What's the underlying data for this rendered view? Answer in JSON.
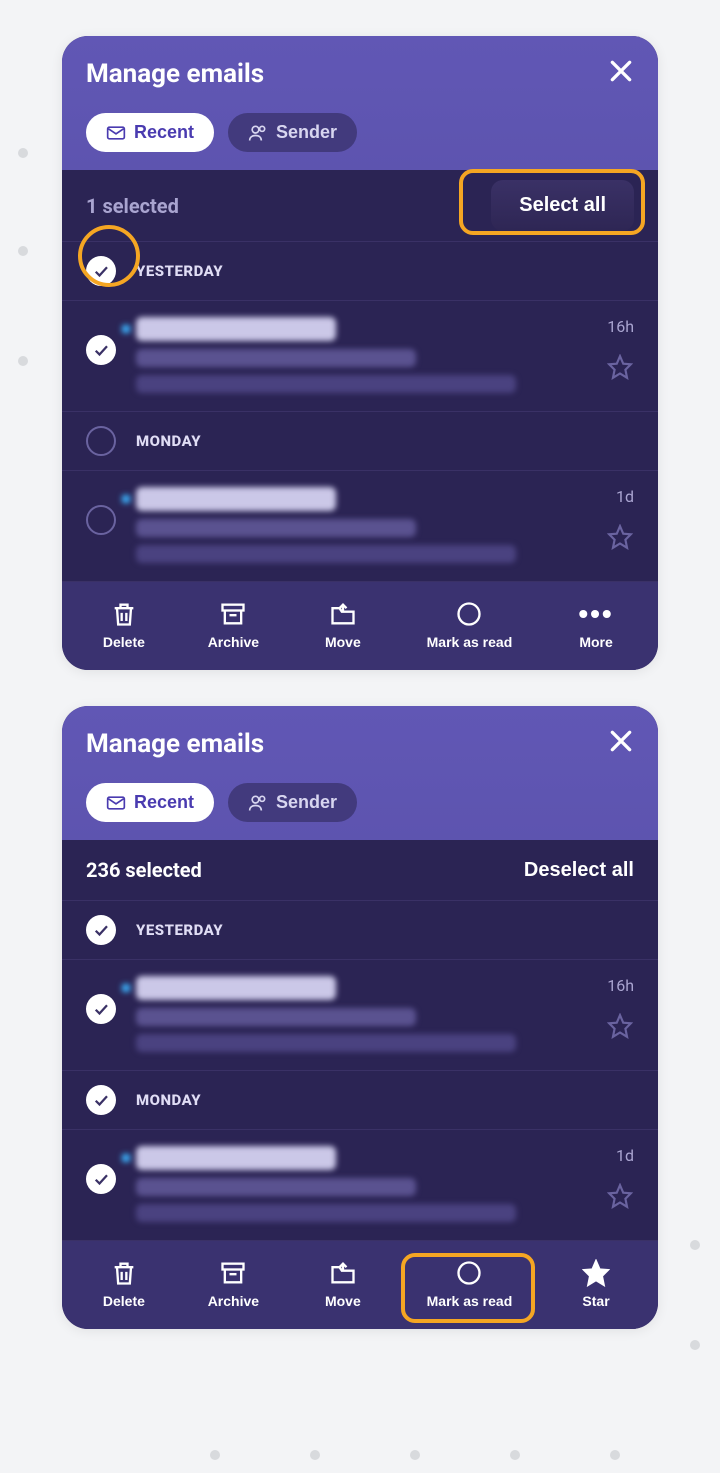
{
  "decorative_dot_color": "#d8dadd",
  "highlight_color": "#f5a623",
  "panels": [
    {
      "title": "Manage emails",
      "filters": {
        "recent": "Recent",
        "sender": "Sender"
      },
      "selection": {
        "count_label": "1 selected",
        "toggle_label": "Select all",
        "toggle_style": "button"
      },
      "groups": [
        {
          "label": "YESTERDAY",
          "checked": true,
          "highlight_check": true,
          "emails": [
            {
              "checked": true,
              "sender": "Clean Email Team",
              "subject": "Review new screened senders",
              "preview": "You are receiving this message because noti...",
              "time": "16h",
              "starred": false
            }
          ]
        },
        {
          "label": "MONDAY",
          "checked": false,
          "emails": [
            {
              "checked": false,
              "sender": "Clean Email Team",
              "subject": "Review new screened senders",
              "preview": "You are receiving this message because noti...",
              "time": "1d",
              "starred": false
            }
          ]
        }
      ],
      "toolbar": [
        {
          "key": "delete",
          "label": "Delete",
          "icon": "trash"
        },
        {
          "key": "archive",
          "label": "Archive",
          "icon": "archive"
        },
        {
          "key": "move",
          "label": "Move",
          "icon": "move"
        },
        {
          "key": "mark_read",
          "label": "Mark as read",
          "icon": "circle"
        },
        {
          "key": "more",
          "label": "More",
          "icon": "dots"
        }
      ],
      "highlights": {
        "select_all_button": true
      }
    },
    {
      "title": "Manage emails",
      "filters": {
        "recent": "Recent",
        "sender": "Sender"
      },
      "selection": {
        "count_label": "236 selected",
        "toggle_label": "Deselect all",
        "toggle_style": "link"
      },
      "groups": [
        {
          "label": "YESTERDAY",
          "checked": true,
          "emails": [
            {
              "checked": true,
              "sender": "Clean Email Team",
              "subject": "Review new screened senders",
              "preview": "You are receiving this message because noti...",
              "time": "16h",
              "starred": false
            }
          ]
        },
        {
          "label": "MONDAY",
          "checked": true,
          "emails": [
            {
              "checked": true,
              "sender": "Clean Email Team",
              "subject": "Review new screened senders",
              "preview": "You are receiving this message because noti...",
              "time": "1d",
              "starred": false
            }
          ]
        }
      ],
      "toolbar": [
        {
          "key": "delete",
          "label": "Delete",
          "icon": "trash"
        },
        {
          "key": "archive",
          "label": "Archive",
          "icon": "archive"
        },
        {
          "key": "move",
          "label": "Move",
          "icon": "move"
        },
        {
          "key": "mark_read",
          "label": "Mark as read",
          "icon": "circle"
        },
        {
          "key": "star",
          "label": "Star",
          "icon": "star-filled"
        }
      ],
      "highlights": {
        "mark_as_read_button": true
      }
    }
  ]
}
